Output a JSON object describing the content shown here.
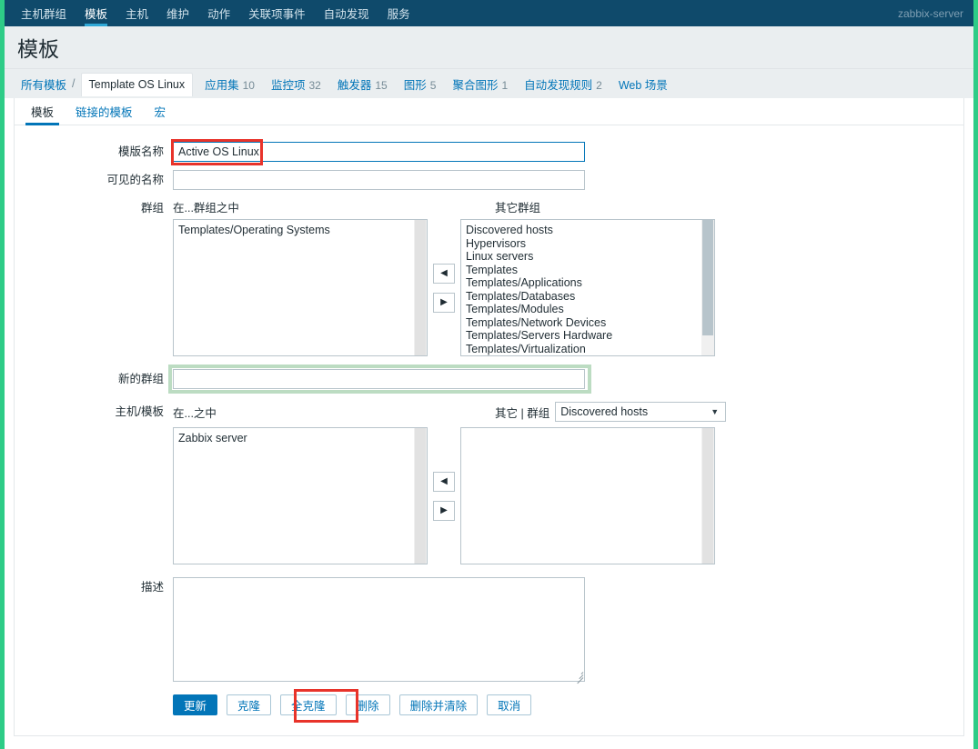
{
  "topnav": {
    "items": [
      {
        "label": "主机群组",
        "active": false
      },
      {
        "label": "模板",
        "active": true
      },
      {
        "label": "主机",
        "active": false
      },
      {
        "label": "维护",
        "active": false
      },
      {
        "label": "动作",
        "active": false
      },
      {
        "label": "关联项事件",
        "active": false
      },
      {
        "label": "自动发现",
        "active": false
      },
      {
        "label": "服务",
        "active": false
      }
    ],
    "server_name": "zabbix-server"
  },
  "page": {
    "title": "模板"
  },
  "breadcrumb": {
    "all_templates": "所有模板",
    "separator": "/",
    "current": "Template OS Linux",
    "objects": [
      {
        "label": "应用集",
        "count": "10"
      },
      {
        "label": "监控项",
        "count": "32"
      },
      {
        "label": "触发器",
        "count": "15"
      },
      {
        "label": "图形",
        "count": "5"
      },
      {
        "label": "聚合图形",
        "count": "1"
      },
      {
        "label": "自动发现规则",
        "count": "2"
      },
      {
        "label": "Web 场景",
        "count": ""
      }
    ]
  },
  "subtabs": [
    {
      "label": "模板",
      "active": true
    },
    {
      "label": "链接的模板",
      "active": false
    },
    {
      "label": "宏",
      "active": false
    }
  ],
  "form": {
    "template_name": {
      "label": "模版名称",
      "value": "Active OS Linux",
      "placeholder": ""
    },
    "visible_name": {
      "label": "可见的名称",
      "value": "",
      "placeholder": ""
    },
    "groups": {
      "label": "群组",
      "in_caption": "在...群组之中",
      "other_caption": "其它群组",
      "in_items": [
        "Templates/Operating Systems"
      ],
      "other_items": [
        "Discovered hosts",
        "Hypervisors",
        "Linux servers",
        "Templates",
        "Templates/Applications",
        "Templates/Databases",
        "Templates/Modules",
        "Templates/Network Devices",
        "Templates/Servers Hardware",
        "Templates/Virtualization"
      ],
      "move_left_icon": "arrow-left-icon",
      "move_right_icon": "arrow-right-icon"
    },
    "new_group": {
      "label": "新的群组",
      "value": "",
      "placeholder": ""
    },
    "hosts_templates": {
      "label": "主机/模板",
      "in_caption": "在...之中",
      "other_caption": "其它 | 群组",
      "in_items": [
        "Zabbix server"
      ],
      "other_items": [],
      "group_select_value": "Discovered hosts",
      "caret_icon": "chevron-down-icon",
      "move_left_icon": "arrow-left-icon",
      "move_right_icon": "arrow-right-icon"
    },
    "description": {
      "label": "描述",
      "value": "",
      "placeholder": ""
    }
  },
  "buttons": [
    {
      "label": "更新",
      "style": "primary"
    },
    {
      "label": "克隆",
      "style": "ghost"
    },
    {
      "label": "全克隆",
      "style": "ghost"
    },
    {
      "label": "删除",
      "style": "ghost"
    },
    {
      "label": "删除并清除",
      "style": "ghost"
    },
    {
      "label": "取消",
      "style": "ghost"
    }
  ],
  "annotations": {
    "red_box_color": "#e8332a",
    "green_box_color": "#bcdcc2",
    "targets": [
      "template-name-input",
      "full-clone-button",
      "new-group-input"
    ]
  },
  "colors": {
    "nav_bg": "#0f4a6b",
    "nav_accent": "#2fa8d6",
    "band_bg": "#eaeef0",
    "link": "#0275b8",
    "edge_stripe": "#2ecc87",
    "text": "#1f2c33"
  }
}
